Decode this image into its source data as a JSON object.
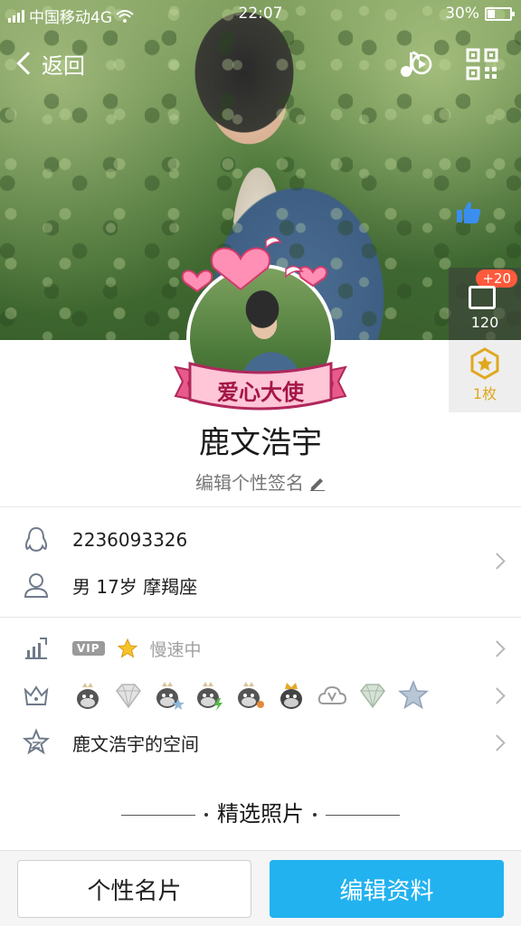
{
  "status_bar": {
    "carrier": "中国移动4G",
    "time": "22:07",
    "battery": "30%"
  },
  "nav": {
    "back_label": "返回"
  },
  "side": {
    "gift_badge": "+20",
    "gift_count": "120",
    "medal_label": "1枚"
  },
  "profile": {
    "ribbon_text": "爱心大使",
    "name": "鹿文浩宇",
    "signature_placeholder": "编辑个性签名"
  },
  "info": {
    "qq_number": "2236093326",
    "details": "男  17岁  摩羯座"
  },
  "vip": {
    "badge": "VIP",
    "status": "慢速中"
  },
  "space": {
    "label": "鹿文浩宇的空间"
  },
  "photos": {
    "title": "精选照片"
  },
  "buttons": {
    "card": "个性名片",
    "edit": "编辑资料"
  },
  "colors": {
    "accent": "#22b2f0",
    "badge_red": "#ff5a3c",
    "medal_gold": "#e0a81f"
  }
}
